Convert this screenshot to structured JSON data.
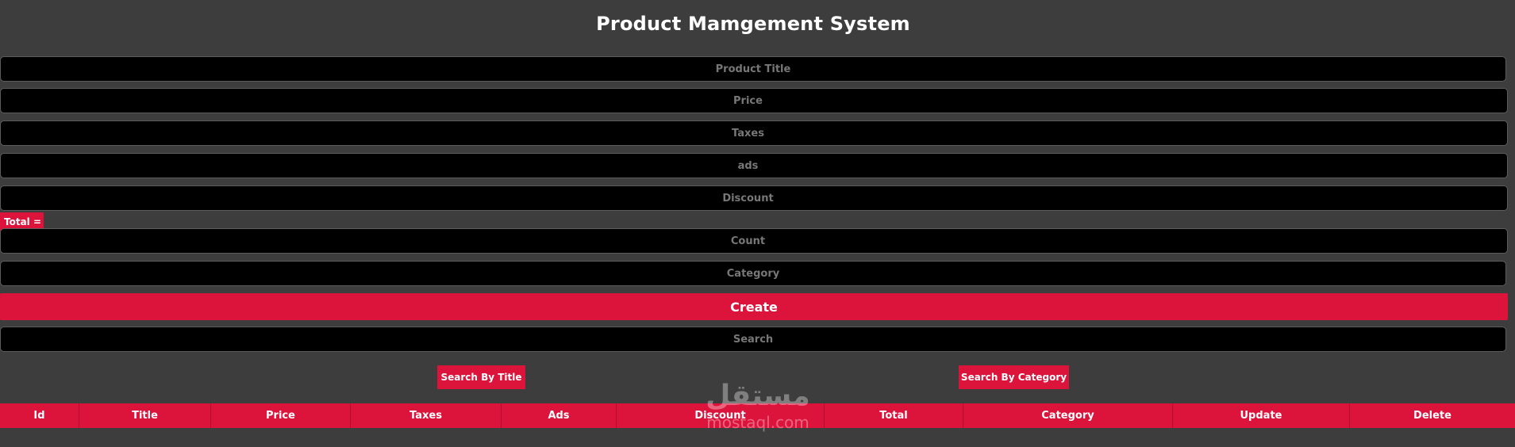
{
  "header": {
    "title": "Product Mamgement System"
  },
  "form": {
    "title_placeholder": "Product Title",
    "price_placeholder": "Price",
    "taxes_placeholder": "Taxes",
    "ads_placeholder": "ads",
    "discount_placeholder": "Discount",
    "total_label": "Total =",
    "count_placeholder": "Count",
    "category_placeholder": "Category",
    "create_label": "Create"
  },
  "search": {
    "placeholder": "Search",
    "by_title_label": "Search By Title",
    "by_category_label": "Search By Category"
  },
  "table": {
    "columns": [
      "Id",
      "Title",
      "Price",
      "Taxes",
      "Ads",
      "Discount",
      "Total",
      "Category",
      "Update",
      "Delete"
    ]
  },
  "watermark": {
    "arabic": "مستقل",
    "latin": "mostaql.com"
  },
  "colors": {
    "background": "#3e3d3e",
    "accent": "#dc143c",
    "field_bg": "#000000",
    "placeholder": "#777777"
  }
}
